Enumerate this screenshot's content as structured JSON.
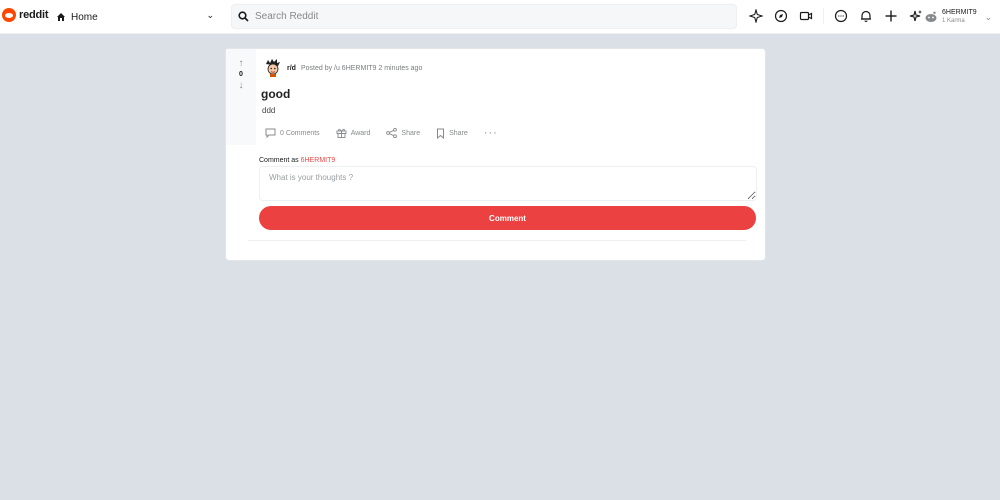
{
  "header": {
    "logo_text": "reddit",
    "home_label": "Home",
    "search_placeholder": "Search Reddit",
    "icons": [
      "popular-icon",
      "explore-icon",
      "video-icon",
      "chat-icon",
      "notification-icon",
      "create-post-icon",
      "premium-icon"
    ],
    "user": {
      "name": "6HERMIT9",
      "karma": "1 Karma"
    }
  },
  "post": {
    "vote_count": "0",
    "subreddit": "r/d",
    "posted_by": "Posted by /u 6HERMIT9 2 minutes ago",
    "title": "good",
    "body": "ddd",
    "actions": {
      "comments": "0 Comments",
      "award": "Award",
      "share": "Share",
      "save": "Share"
    },
    "comment_as_label": "Comment as",
    "comment_user": "6HERMIT9",
    "comment_placeholder": "What is your thoughts ?",
    "comment_button": "Comment"
  },
  "colors": {
    "brand": "#ff4500",
    "accent": "#ec4141",
    "background": "#dae0e6"
  }
}
